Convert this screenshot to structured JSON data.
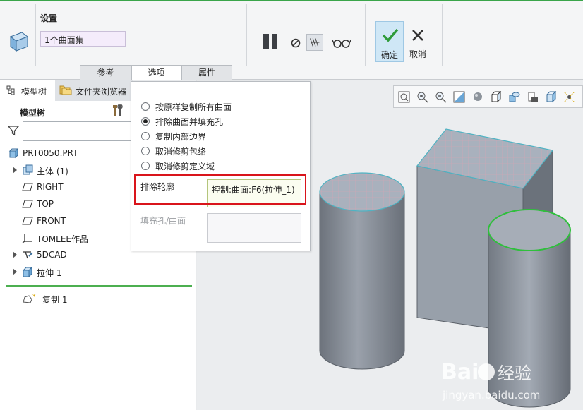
{
  "ribbon": {
    "settings_title": "设置",
    "collector_value": "1个曲面集",
    "ok_label": "确定",
    "cancel_label": "取消",
    "tabs": [
      {
        "label": "参考"
      },
      {
        "label": "选项"
      },
      {
        "label": "属性"
      }
    ],
    "icons": [
      "copy-surface-feature-icon",
      "pause-icon",
      "no-preview-icon",
      "verify-mode-icon",
      "glasses-preview-icon",
      "checkmark-icon",
      "x-cancel-icon"
    ]
  },
  "left_panel": {
    "tabs": [
      {
        "label": "模型树",
        "icon": "model-tree-icon"
      },
      {
        "label": "文件夹浏览器",
        "icon": "folder-browser-icon"
      }
    ],
    "tree_header": "模型树",
    "filter_placeholder": "",
    "tree": [
      {
        "label": "PRT0050.PRT",
        "icon": "part-icon",
        "expandable": false
      },
      {
        "label": "主体 (1)",
        "icon": "body-icon",
        "expandable": true
      },
      {
        "label": "RIGHT",
        "icon": "datum-plane-icon",
        "expandable": false
      },
      {
        "label": "TOP",
        "icon": "datum-plane-icon",
        "expandable": false
      },
      {
        "label": "FRONT",
        "icon": "datum-plane-icon",
        "expandable": false
      },
      {
        "label": "TOMLEE作品",
        "icon": "coordinate-system-icon",
        "expandable": false
      },
      {
        "label": "5DCAD",
        "icon": "sketch-icon",
        "expandable": true
      },
      {
        "label": "拉伸 1",
        "icon": "extrude-icon",
        "expandable": true
      },
      {
        "label": "复制 1",
        "icon": "copy-feature-icon",
        "expandable": false
      }
    ]
  },
  "options_panel": {
    "radio_options": [
      {
        "label": "按原样复制所有曲面",
        "selected": false
      },
      {
        "label": "排除曲面并填充孔",
        "selected": true
      },
      {
        "label": "复制内部边界",
        "selected": false
      },
      {
        "label": "取消修剪包络",
        "selected": false
      },
      {
        "label": "取消修剪定义域",
        "selected": false
      }
    ],
    "exclude_label": "排除轮廓",
    "exclude_value": "控制:曲面:F6(拉伸_1)",
    "fill_label": "填充孔/曲面",
    "fill_value": ""
  },
  "view_toolbar": {
    "icons": [
      "refit-icon",
      "zoom-in-icon",
      "zoom-out-icon",
      "repaint-icon",
      "display-style-icon",
      "saved-orientations-icon",
      "view-manager-icon",
      "perspective-icon",
      "spin-center-icon",
      "datum-display-icon"
    ]
  },
  "watermark": {
    "brand": "Baidu经验",
    "url": "jingyan.baidu.com"
  },
  "colors": {
    "accent_green": "#3aa54a",
    "highlight_red": "#d9141b",
    "ok_blue": "#cfe7f6",
    "model_gray": "#8f96a0",
    "selection_green": "#2fbf3c"
  }
}
